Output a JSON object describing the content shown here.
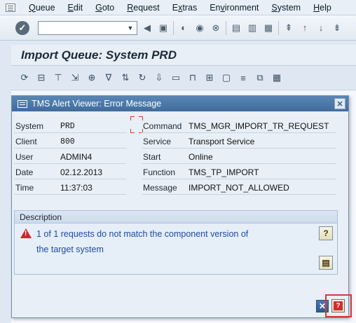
{
  "menubar": {
    "items": [
      {
        "label": "Queue",
        "ul": "Q",
        "rest": "ueue"
      },
      {
        "label": "Edit",
        "ul": "E",
        "rest": "dit"
      },
      {
        "label": "Goto",
        "ul": "G",
        "rest": "oto"
      },
      {
        "label": "Request",
        "ul": "R",
        "rest": "equest"
      },
      {
        "label": "Extras",
        "ul": "x",
        "pre": "E",
        "rest": "tras"
      },
      {
        "label": "Environment",
        "ul": "v",
        "pre": "En",
        "rest": "ironment"
      },
      {
        "label": "System",
        "ul": "S",
        "rest": "ystem"
      },
      {
        "label": "Help",
        "ul": "H",
        "rest": "elp"
      }
    ]
  },
  "toolbar": {
    "command_value": ""
  },
  "page": {
    "title": "Import Queue: System PRD"
  },
  "dialog": {
    "title": "TMS Alert Viewer: Error Message",
    "close_label": "✕",
    "left_fields": [
      {
        "label": "System",
        "value": "PRD"
      },
      {
        "label": "Client",
        "value": "800"
      },
      {
        "label": "User",
        "value": "ADMIN4"
      },
      {
        "label": "Date",
        "value": "02.12.2013"
      },
      {
        "label": "Time",
        "value": "11:37:03"
      }
    ],
    "right_fields": [
      {
        "label": "Command",
        "value": "TMS_MGR_IMPORT_TR_REQUEST"
      },
      {
        "label": "Service",
        "value": "Transport Service"
      },
      {
        "label": "Start",
        "value": "Online"
      },
      {
        "label": "Function",
        "value": "TMS_TP_IMPORT"
      },
      {
        "label": "Message",
        "value": "IMPORT_NOT_ALLOWED"
      }
    ],
    "description": {
      "heading": "Description",
      "line1": "1 of 1 requests do not match the component version of",
      "line2": "the target system"
    },
    "cancel_label": "✕",
    "help_label": "?"
  }
}
